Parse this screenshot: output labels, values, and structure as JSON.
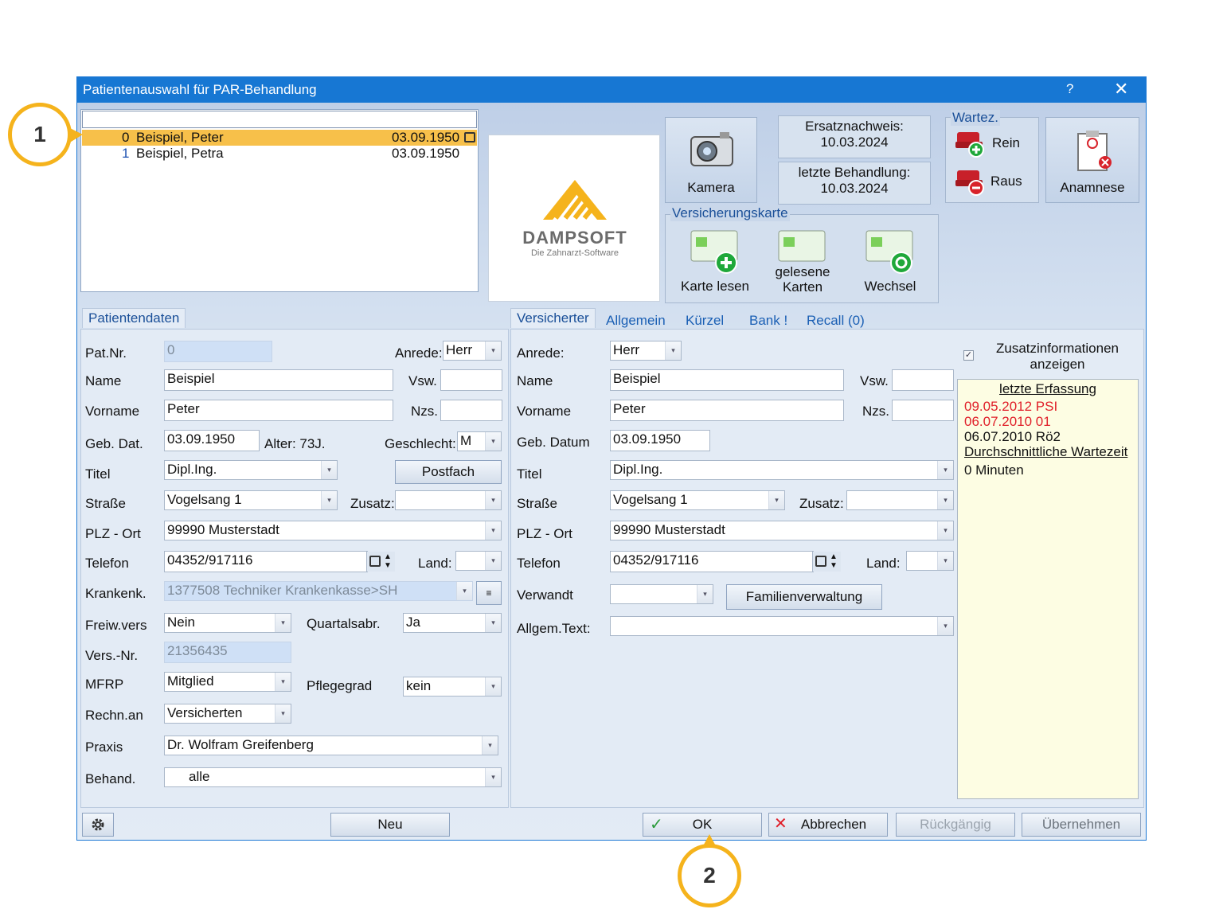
{
  "window": {
    "title": "Patientenauswahl für PAR-Behandlung",
    "help": "?",
    "close": "✕"
  },
  "search": {
    "value": ""
  },
  "patients": [
    {
      "num": "0",
      "name": "Beispiel, Peter",
      "dob": "03.09.1950",
      "selected": true
    },
    {
      "num": "1",
      "name": "Beispiel, Petra",
      "dob": "03.09.1950",
      "selected": false
    }
  ],
  "logo": {
    "brand": "DAMPSOFT",
    "tagline": "Die Zahnarzt-Software"
  },
  "kamera": {
    "label": "Kamera"
  },
  "ersatz": {
    "label": "Ersatznachweis:",
    "date": "10.03.2024"
  },
  "letzte": {
    "label": "letzte Behandlung:",
    "date": "10.03.2024"
  },
  "wartez": {
    "title": "Wartez.",
    "rein": "Rein",
    "raus": "Raus"
  },
  "anamnese": {
    "label": "Anamnese"
  },
  "vk": {
    "title": "Versicherungskarte",
    "lesen": "Karte lesen",
    "gelesene1": "gelesene",
    "gelesene2": "Karten",
    "wechsel": "Wechsel"
  },
  "left": {
    "tab": "Patientendaten",
    "patnr_label": "Pat.Nr.",
    "patnr": "0",
    "anrede_label": "Anrede:",
    "anrede": "Herr",
    "name_label": "Name",
    "name": "Beispiel",
    "vsw_label": "Vsw.",
    "vsw": "",
    "vorname_label": "Vorname",
    "vorname": "Peter",
    "nzs_label": "Nzs.",
    "nzs": "",
    "geb_label": "Geb. Dat.",
    "geb": "03.09.1950",
    "alter": "Alter: 73J.",
    "geschlecht_label": "Geschlecht:",
    "geschlecht": "M",
    "titel_label": "Titel",
    "titel": "Dipl.Ing.",
    "postfach": "Postfach",
    "strasse_label": "Straße",
    "strasse": "Vogelsang 1",
    "zusatz_label": "Zusatz:",
    "zusatz": "",
    "plz_label": "PLZ - Ort",
    "plz": "99990 Musterstadt",
    "telefon_label": "Telefon",
    "telefon": "04352/917116",
    "land_label": "Land:",
    "land": "",
    "kk_label": "Krankenk.",
    "kk": "1377508 Techniker Krankenkasse>SH",
    "freiw_label": "Freiw.vers",
    "freiw": "Nein",
    "quartal_label": "Quartalsabr.",
    "quartal": "Ja",
    "versnr_label": "Vers.-Nr.",
    "versnr": "21356435",
    "mfrp_label": "MFRP",
    "mfrp": "Mitglied",
    "pflege_label": "Pflegegrad",
    "pflege": "kein",
    "rechn_label": "Rechn.an",
    "rechn": "Versicherten",
    "praxis_label": "Praxis",
    "praxis": "Dr. Wolfram Greifenberg",
    "behand_label": "Behand.",
    "behand": "alle"
  },
  "right": {
    "tabs": [
      "Versicherter",
      "Allgemein",
      "Kürzel",
      "Bank !",
      "Recall (0)"
    ],
    "anrede_label": "Anrede:",
    "anrede": "Herr",
    "name_label": "Name",
    "name": "Beispiel",
    "vsw_label": "Vsw.",
    "vsw": "",
    "vorname_label": "Vorname",
    "vorname": "Peter",
    "nzs_label": "Nzs.",
    "nzs": "",
    "geb_label": "Geb. Datum",
    "geb": "03.09.1950",
    "titel_label": "Titel",
    "titel": "Dipl.Ing.",
    "strasse_label": "Straße",
    "strasse": "Vogelsang 1",
    "zusatz_label": "Zusatz:",
    "zusatz": "",
    "plz_label": "PLZ - Ort",
    "plz": "99990 Musterstadt",
    "telefon_label": "Telefon",
    "telefon": "04352/917116",
    "land_label": "Land:",
    "land": "",
    "verwandt_label": "Verwandt",
    "verwandt": "",
    "familien": "Familienverwaltung",
    "allgem_label": "Allgem.Text:",
    "allgem": ""
  },
  "zusatz": {
    "checkbox": "✓",
    "label1": "Zusatzinformationen",
    "label2": "anzeigen",
    "heading": "letzte Erfassung",
    "entry1": "09.05.2012 PSI",
    "entry2": "06.07.2010 01",
    "entry3": "06.07.2010 Rö2",
    "wait_heading": "Durchschnittliche Wartezeit",
    "wait_value": "0 Minuten"
  },
  "footer": {
    "neu": "Neu",
    "ok": "OK",
    "abbrechen": "Abbrechen",
    "rueck": "Rückgängig",
    "uebernehmen": "Übernehmen"
  },
  "callouts": {
    "c1": "1",
    "c2": "2"
  },
  "colors": {
    "accent": "#1777d3",
    "selection": "#f7c04a",
    "callout": "#f5b31c",
    "red": "#e0202a"
  }
}
